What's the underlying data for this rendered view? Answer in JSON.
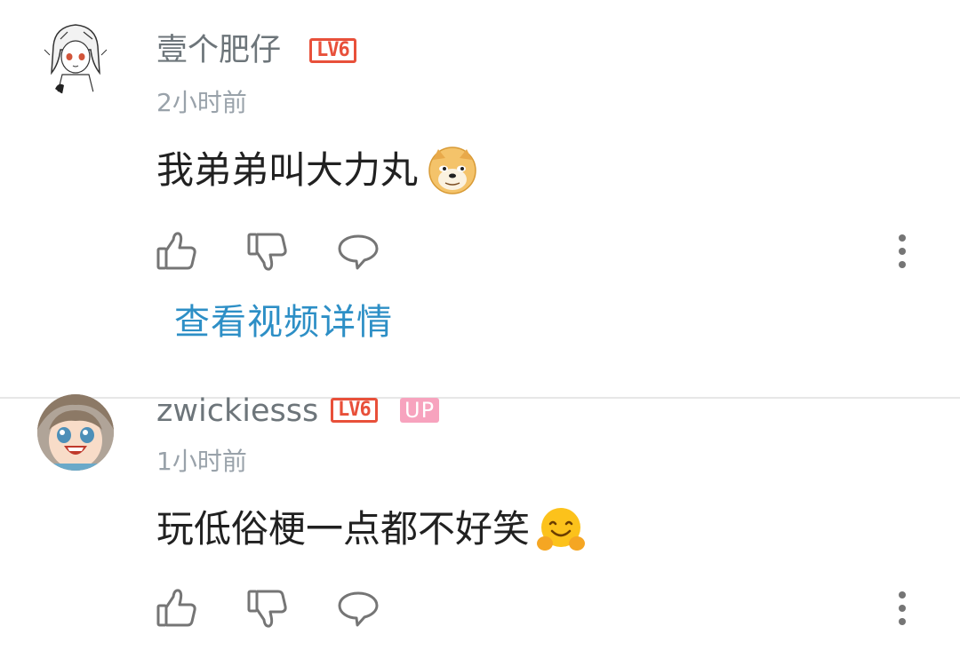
{
  "comments": [
    {
      "username": "壹个肥仔",
      "level_badge": "LV6",
      "time": "2小时前",
      "text": "我弟弟叫大力丸",
      "emoji": "doge-emoji",
      "view_video_link": "查看视频详情"
    },
    {
      "username": "zwickiesss",
      "level_badge": "LV6",
      "up_badge": "UP",
      "time": "1小时前",
      "text": "玩低俗梗一点都不好笑",
      "emoji": "hugging-face-emoji"
    }
  ],
  "icons": {
    "like": "thumbs-up-icon",
    "dislike": "thumbs-down-icon",
    "reply": "comment-bubble-icon",
    "more": "more-vertical-icon"
  },
  "colors": {
    "link": "#2d8fc6",
    "level_badge": "#e8503a",
    "up_badge": "#f7a3be",
    "username": "#6d757a",
    "timestamp": "#99a2aa"
  }
}
